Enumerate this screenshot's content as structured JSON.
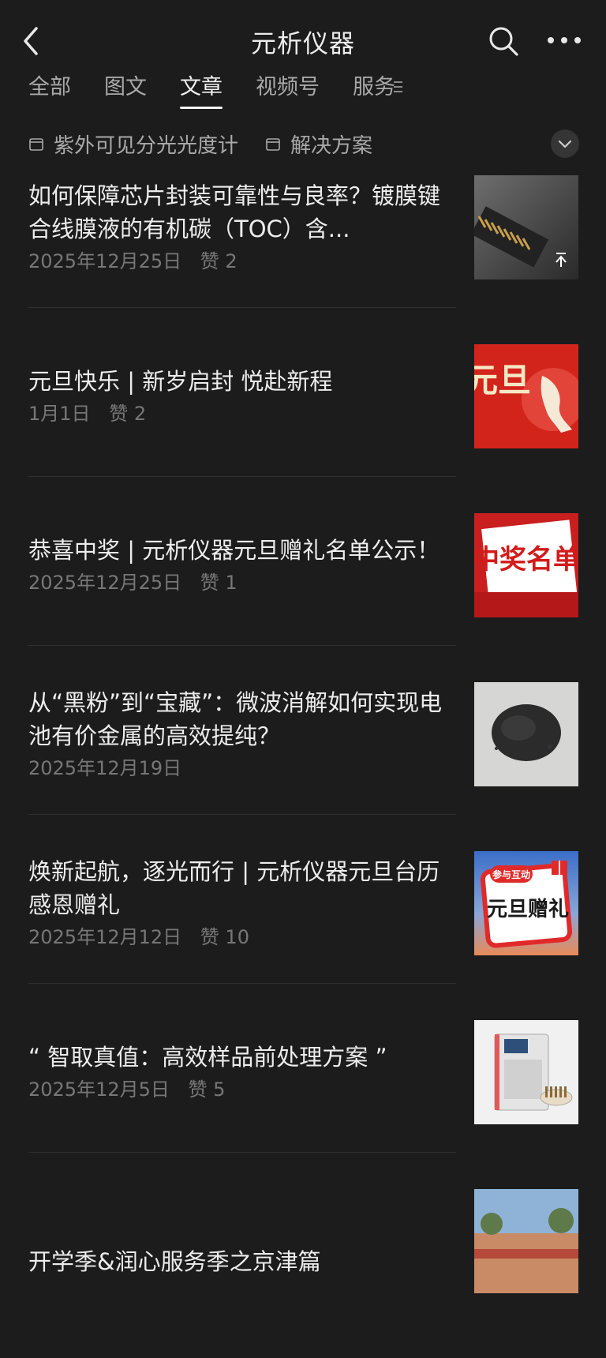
{
  "header": {
    "title": "元析仪器"
  },
  "tabs": [
    {
      "label": "全部"
    },
    {
      "label": "图文"
    },
    {
      "label": "文章"
    },
    {
      "label": "视频号"
    },
    {
      "label": "服务"
    }
  ],
  "filters": [
    {
      "label": "紫外可见分光光度计"
    },
    {
      "label": "解决方案"
    }
  ],
  "articles": [
    {
      "title": "如何保障芯片封装可靠性与良率？镀膜键合线膜液的有机碳（TOC）含...",
      "date": "2025年12月25日",
      "likes": "赞 2",
      "thumb": "chip-image"
    },
    {
      "title": "元旦快乐 | 新岁启封 悦赴新程",
      "date": "1月1日",
      "likes": "赞 2",
      "thumb": "new-year-image",
      "thumb_text": "元旦"
    },
    {
      "title": "恭喜中奖 | 元析仪器元旦赠礼名单公示！",
      "date": "2025年12月25日",
      "likes": "赞 1",
      "thumb": "winner-list-image",
      "thumb_text": "中奖名单"
    },
    {
      "title": "从“黑粉”到“宝藏”：微波消解如何实现电池有价金属的高效提纯？",
      "date": "2025年12月19日",
      "likes": "",
      "thumb": "black-powder-image"
    },
    {
      "title": "焕新起航，逐光而行 | 元析仪器元旦台历感恩赠礼",
      "date": "2025年12月12日",
      "likes": "赞 10",
      "thumb": "gift-image",
      "thumb_text": "元旦赠礼",
      "thumb_tag": "参与互动"
    },
    {
      "title": "“ 智取真值：高效样品前处理方案 ”",
      "date": "2025年12月5日",
      "likes": "赞 5",
      "thumb": "instrument-image"
    },
    {
      "title": "开学季&润心服务季之京津篇",
      "date": "",
      "likes": "",
      "thumb": "campus-image"
    }
  ]
}
